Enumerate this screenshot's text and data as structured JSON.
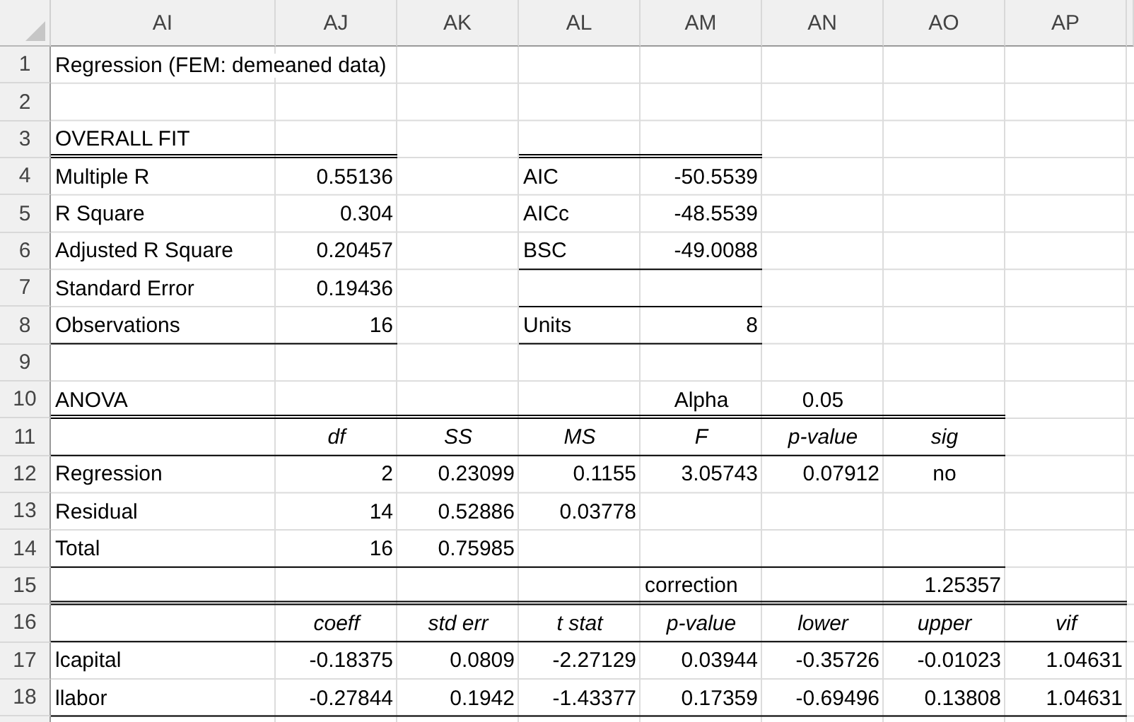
{
  "columns": [
    "AI",
    "AJ",
    "AK",
    "AL",
    "AM",
    "AN",
    "AO",
    "AP"
  ],
  "rows": [
    {
      "number": "1",
      "kind": "data",
      "cells": [
        "Regression (FEM: demeaned data)",
        null,
        null,
        null,
        null,
        null,
        null,
        null
      ]
    },
    {
      "number": "2",
      "kind": "data"
    },
    {
      "number": "3",
      "kind": "data",
      "cells": [
        "OVERALL FIT",
        null,
        null,
        null,
        null,
        null,
        null,
        null
      ]
    },
    {
      "number": "4",
      "kind": "data",
      "cells": [
        "Multiple R",
        "0.55136",
        null,
        "AIC",
        "-50.5539",
        null,
        null,
        null
      ]
    },
    {
      "number": "5",
      "kind": "data",
      "cells": [
        "R Square",
        "0.304",
        null,
        "AICc",
        "-48.5539",
        null,
        null,
        null
      ]
    },
    {
      "number": "6",
      "kind": "data",
      "cells": [
        "Adjusted R Square",
        "0.20457",
        null,
        "BSC",
        "-49.0088",
        null,
        null,
        null
      ]
    },
    {
      "number": "7",
      "kind": "data",
      "cells": [
        "Standard Error",
        "0.19436",
        null,
        null,
        null,
        null,
        null,
        null
      ]
    },
    {
      "number": "8",
      "kind": "data",
      "cells": [
        "Observations",
        "16",
        null,
        "Units",
        "8",
        null,
        null,
        null
      ]
    },
    {
      "number": "9",
      "kind": "data"
    },
    {
      "number": "10",
      "kind": "data",
      "cells": [
        "ANOVA",
        null,
        null,
        null,
        "Alpha",
        "0.05",
        null,
        null
      ]
    },
    {
      "number": "11",
      "kind": "header",
      "cells": [
        null,
        "df",
        "SS",
        "MS",
        "F",
        "p-value",
        "sig",
        null
      ]
    },
    {
      "number": "12",
      "kind": "data",
      "cells": [
        "Regression",
        "2",
        "0.23099",
        "0.1155",
        "3.05743",
        "0.07912",
        "no",
        null
      ]
    },
    {
      "number": "13",
      "kind": "data",
      "cells": [
        "Residual",
        "14",
        "0.52886",
        "0.03778",
        null,
        null,
        null,
        null
      ]
    },
    {
      "number": "14",
      "kind": "data",
      "cells": [
        "Total",
        "16",
        "0.75985",
        null,
        null,
        null,
        null,
        null
      ]
    },
    {
      "number": "15",
      "kind": "data",
      "cells": [
        null,
        null,
        null,
        null,
        "correction",
        null,
        "1.25357",
        null
      ]
    },
    {
      "number": "16",
      "kind": "header",
      "cells": [
        null,
        "coeff",
        "std err",
        "t stat",
        "p-value",
        "lower",
        "upper",
        "vif"
      ]
    },
    {
      "number": "17",
      "kind": "data",
      "cells": [
        "lcapital",
        "-0.18375",
        "0.0809",
        "-2.27129",
        "0.03944",
        "-0.35726",
        "-0.01023",
        "1.04631"
      ]
    },
    {
      "number": "18",
      "kind": "data",
      "cells": [
        "llabor",
        "-0.27844",
        "0.1942",
        "-1.43377",
        "0.17359",
        "-0.69496",
        "0.13808",
        "1.04631"
      ]
    }
  ]
}
